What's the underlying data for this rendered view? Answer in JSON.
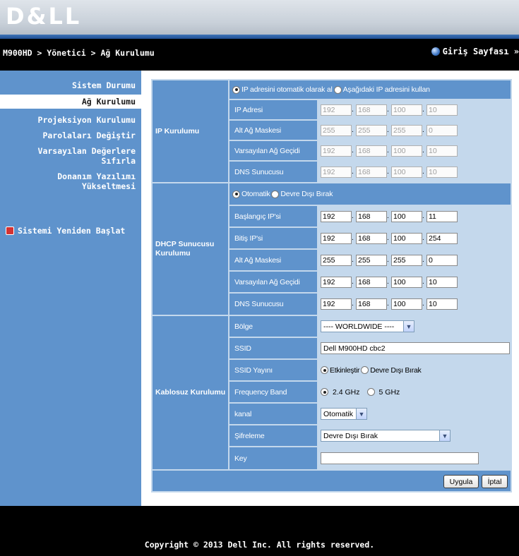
{
  "header": {
    "logo": "D&LL",
    "breadcrumb": "M900HD > Yönetici > Ağ Kurulumu",
    "home_link": "Giriş Sayfası »"
  },
  "sidebar": {
    "items": [
      {
        "label": "Sistem Durumu"
      },
      {
        "label": "Ağ Kurulumu"
      },
      {
        "label": "Projeksiyon Kurulumu"
      },
      {
        "label": "Parolaları Değiştir"
      },
      {
        "label": "Varsayılan Değerlere Sıfırla"
      },
      {
        "label": "Donanım Yazılımı Yükseltmesi"
      }
    ],
    "reboot": "Sistemi Yeniden Başlat"
  },
  "ip_setup": {
    "group_label": "IP Kurulumu",
    "mode_auto": "IP adresini otomatik olarak al",
    "mode_manual": "Aşağıdaki IP adresini kullan",
    "rows": [
      {
        "label": "IP Adresi",
        "octets": [
          "192",
          "168",
          "100",
          "10"
        ]
      },
      {
        "label": "Alt Ağ Maskesi",
        "octets": [
          "255",
          "255",
          "255",
          "0"
        ]
      },
      {
        "label": "Varsayılan Ağ Geçidi",
        "octets": [
          "192",
          "168",
          "100",
          "10"
        ]
      },
      {
        "label": "DNS Sunucusu",
        "octets": [
          "192",
          "168",
          "100",
          "10"
        ]
      }
    ]
  },
  "dhcp": {
    "group_label": "DHCP Sunucusu Kurulumu",
    "mode_auto": "Otomatik",
    "mode_disable": "Devre Dışı Bırak",
    "rows": [
      {
        "label": "Başlangıç IP'si",
        "octets": [
          "192",
          "168",
          "100",
          "11"
        ]
      },
      {
        "label": "Bitiş IP'si",
        "octets": [
          "192",
          "168",
          "100",
          "254"
        ]
      },
      {
        "label": "Alt Ağ Maskesi",
        "octets": [
          "255",
          "255",
          "255",
          "0"
        ]
      },
      {
        "label": "Varsayılan Ağ Geçidi",
        "octets": [
          "192",
          "168",
          "100",
          "10"
        ]
      },
      {
        "label": "DNS Sunucusu",
        "octets": [
          "192",
          "168",
          "100",
          "10"
        ]
      }
    ]
  },
  "wireless": {
    "group_label": "Kablosuz Kurulumu",
    "region_label": "Bölge",
    "region_value": "---- WORLDWIDE ----",
    "ssid_label": "SSID",
    "ssid_value": "Dell M900HD cbc2",
    "broadcast_label": "SSID Yayını",
    "broadcast_on": "Etkinleştir",
    "broadcast_off": "Devre Dışı Bırak",
    "band_label": "Frequency Band",
    "band_24": "2.4 GHz",
    "band_5": "5 GHz",
    "channel_label": "kanal",
    "channel_value": "Otomatik",
    "encryption_label": "Şifreleme",
    "encryption_value": "Devre Dışı Bırak",
    "key_label": "Key",
    "key_value": ""
  },
  "buttons": {
    "apply": "Uygula",
    "cancel": "İptal"
  },
  "footer": {
    "copyright": "Copyright © 2013 Dell Inc. All rights reserved."
  },
  "colors": {
    "sidebar_blue": "#5f93cc",
    "panel_bg": "#c4d8ec",
    "bar_black": "#000000"
  }
}
